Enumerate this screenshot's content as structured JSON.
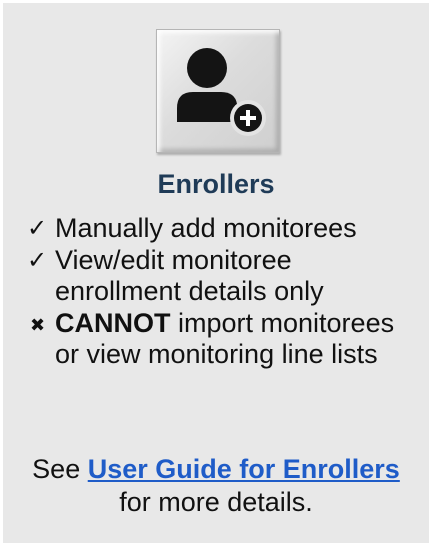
{
  "role": {
    "title": "Enrollers",
    "icon": "user-add-icon"
  },
  "permissions": [
    {
      "type": "allow",
      "icon": "check-icon",
      "symbol": "✓",
      "bold": "",
      "text": "Manually add monitorees"
    },
    {
      "type": "allow",
      "icon": "check-icon",
      "symbol": "✓",
      "bold": "",
      "text": "View/edit monitoree enrollment details only"
    },
    {
      "type": "deny",
      "icon": "cross-icon",
      "symbol": "✖",
      "bold": "CANNOT",
      "text": " import monitorees or view monitoring line lists"
    }
  ],
  "footer": {
    "prefix": "See ",
    "link_label": "User Guide for Enrollers",
    "suffix": " for more details."
  },
  "colors": {
    "card_background": "#e8e8e8",
    "title": "#1f3b57",
    "link": "#1f5cc8",
    "icon": "#111111"
  }
}
